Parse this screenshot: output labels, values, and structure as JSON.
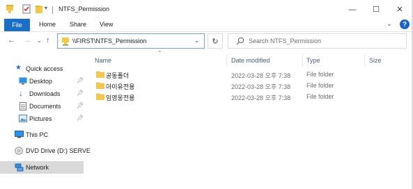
{
  "titlebar": {
    "title": "NTFS_Permission",
    "icons": [
      "folder-icon",
      "properties-check-icon",
      "new-folder-icon",
      "customize-dropdown-icon"
    ],
    "minimize": "—",
    "maximize": "☐",
    "close": "✕"
  },
  "ribbon": {
    "tabs": [
      "File",
      "Home",
      "Share",
      "View"
    ],
    "help": "?"
  },
  "address_bar": {
    "path": "\\\\FIRST\\NTFS_Permission",
    "search_placeholder": "Search NTFS_Permission"
  },
  "nav_pane": {
    "items": [
      {
        "label": "Quick access",
        "icon": "star-icon"
      },
      {
        "label": "Desktop",
        "icon": "desktop-icon",
        "pinned": true
      },
      {
        "label": "Downloads",
        "icon": "download-arrow-icon",
        "pinned": true
      },
      {
        "label": "Documents",
        "icon": "documents-icon",
        "pinned": true
      },
      {
        "label": "Pictures",
        "icon": "pictures-icon",
        "pinned": true
      },
      {
        "label": "This PC",
        "icon": "monitor-icon"
      },
      {
        "label": "DVD Drive (D:) SERVE",
        "icon": "dvd-icon"
      },
      {
        "label": "Network",
        "icon": "network-icon",
        "selected": true
      }
    ]
  },
  "file_list": {
    "columns": [
      "Name",
      "Date modified",
      "Type",
      "Size"
    ],
    "rows": [
      {
        "name": "공동폴더",
        "date": "2022-03-28 오후 7:38",
        "type": "File folder"
      },
      {
        "name": "아이유전용",
        "date": "2022-03-28 오후 7:38",
        "type": "File folder"
      },
      {
        "name": "임영웅전용",
        "date": "2022-03-28 오후 7:38",
        "type": "File folder"
      }
    ]
  },
  "colors": {
    "file_tab": "#1a6ec7",
    "folder": "#f4c84a",
    "selection": "#d9d9d9",
    "address_border": "#7a9cd6"
  }
}
